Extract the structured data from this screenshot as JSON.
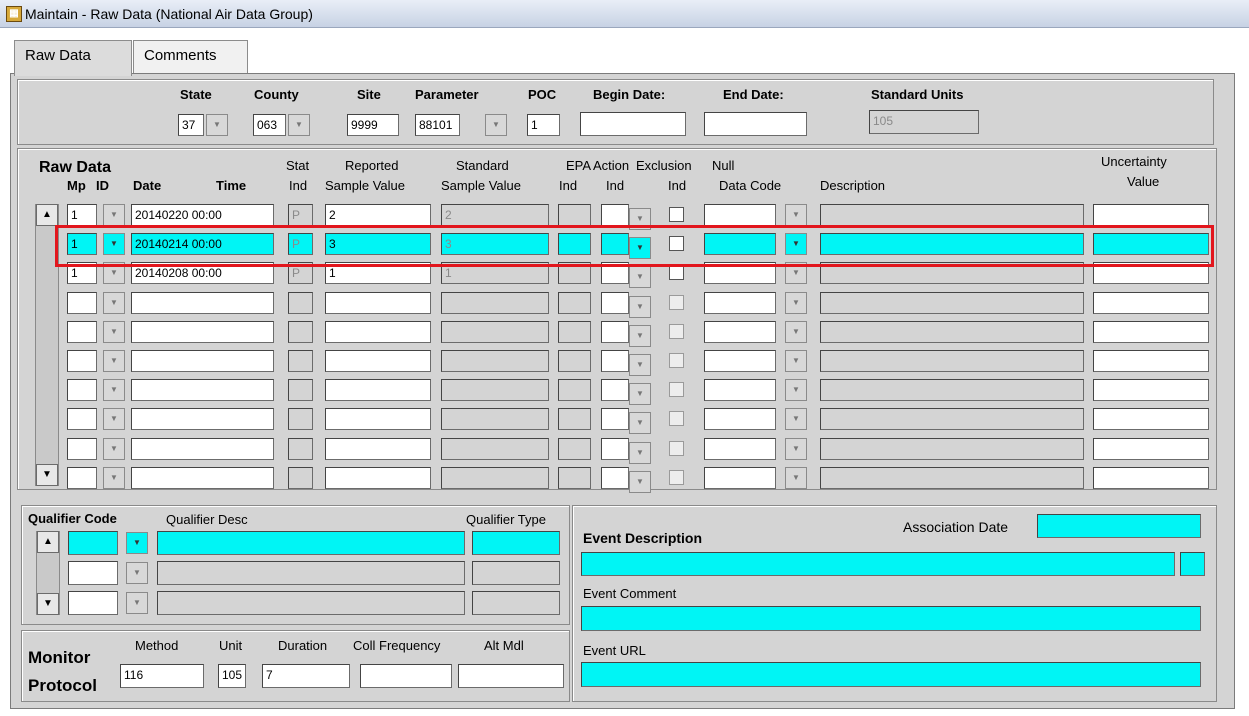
{
  "window": {
    "title": "Maintain - Raw Data (National Air Data Group)",
    "icon": "form-icon"
  },
  "tabs": [
    {
      "label": "Raw Data"
    },
    {
      "label": "Comments"
    }
  ],
  "key": {
    "labels": {
      "state": "State",
      "county": "County",
      "site": "Site",
      "parameter": "Parameter",
      "poc": "POC",
      "begin": "Begin Date:",
      "end": "End Date:",
      "units": "Standard Units"
    },
    "values": {
      "state": "37",
      "county": "063",
      "site": "9999",
      "parameter": "88101",
      "poc": "1",
      "begin": "",
      "end": "",
      "units": "105"
    }
  },
  "raw": {
    "title": "Raw Data",
    "headers": {
      "mp": "Mp",
      "id": "ID",
      "date": "Date",
      "time": "Time",
      "stat1": "Stat",
      "stat2": "Ind",
      "rep1": "Reported",
      "rep2": "Sample Value",
      "std1": "Standard",
      "std2": "Sample  Value",
      "epa1": "EPA",
      "epa2": "Ind",
      "act1": "Action",
      "act2": "Ind",
      "exc1": "Exclusion",
      "exc2": "Ind",
      "null1": "Null",
      "null2": "Data Code",
      "desc": "Description",
      "unc1": "Uncertainty",
      "unc2": "Value"
    },
    "rows": [
      {
        "mp": "1",
        "datetime": "20140220 00:00",
        "stat": "P",
        "reported": "2",
        "standard": "2"
      },
      {
        "mp": "1",
        "datetime": "20140214 00:00",
        "stat": "P",
        "reported": "3",
        "standard": "3"
      },
      {
        "mp": "1",
        "datetime": "20140208 00:00",
        "stat": "P",
        "reported": "1",
        "standard": "1"
      }
    ]
  },
  "qualifier": {
    "code": "Qualifier Code",
    "desc": "Qualifier Desc",
    "type": "Qualifier Type"
  },
  "event": {
    "description": "Event Description",
    "assoc": "Association Date",
    "comment": "Event Comment",
    "url": "Event URL"
  },
  "monitor": {
    "title1": "Monitor",
    "title2": "Protocol",
    "labels": {
      "method": "Method",
      "unit": "Unit",
      "duration": "Duration",
      "freq": "Coll Frequency",
      "altmdl": "Alt Mdl"
    },
    "values": {
      "method": "116",
      "unit": "105",
      "duration": "7",
      "freq": "",
      "altmdl": ""
    }
  },
  "colors": {
    "highlight": "#00f5f5",
    "annotation": "#e2161d",
    "panel": "#d4d4d4"
  }
}
